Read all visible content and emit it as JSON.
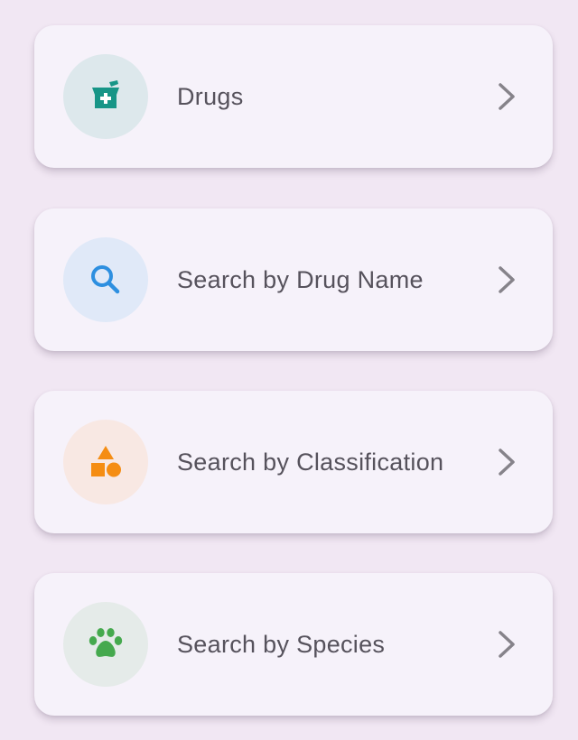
{
  "menu": {
    "items": [
      {
        "label": "Drugs",
        "icon": "mortar-pestle-icon",
        "icon_color": "#179587",
        "icon_bg": "#DDE8EC"
      },
      {
        "label": "Search by Drug Name",
        "icon": "search-icon",
        "icon_color": "#2D8FE0",
        "icon_bg": "#E0E9F8"
      },
      {
        "label": "Search by Classification",
        "icon": "category-shapes-icon",
        "icon_color": "#F58D13",
        "icon_bg": "#F8E8E3"
      },
      {
        "label": "Search by Species",
        "icon": "paw-icon",
        "icon_color": "#45A94E",
        "icon_bg": "#E5EBE9"
      }
    ],
    "chevron_color": "#86838A"
  }
}
